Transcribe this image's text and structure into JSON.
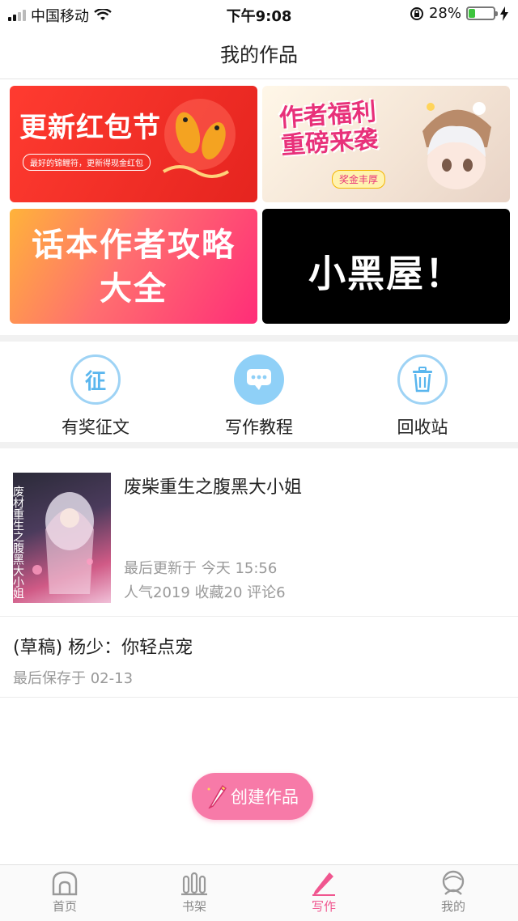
{
  "status_bar": {
    "carrier": "中国移动",
    "time": "下午9:08",
    "battery_percent": "28%",
    "battery_level": 0.28
  },
  "header": {
    "title": "我的作品"
  },
  "banners": {
    "red_envelope": {
      "title": "更新红包节",
      "subtitle": "最好的锦鲤符，更新得现金红包"
    },
    "author_welfare": {
      "title_line1": "作者福利",
      "title_line2": "重磅来袭",
      "tag": "奖金丰厚"
    },
    "guide": {
      "title_line1": "话本作者攻略",
      "title_line2": "大全"
    },
    "blackroom": {
      "title": "小黑屋！"
    }
  },
  "actions": [
    {
      "label": "有奖征文",
      "icon": "zheng-icon",
      "glyph": "征"
    },
    {
      "label": "写作教程",
      "icon": "chat-bubble-icon"
    },
    {
      "label": "回收站",
      "icon": "trash-icon"
    }
  ],
  "works": [
    {
      "title": "废柴重生之腹黑大小姐",
      "updated": "最后更新于 今天 15:56",
      "stats": "人气2019 收藏20 评论6",
      "cover_text": "废材重生之腹黑大小姐"
    },
    {
      "title": "(草稿) 杨少：你轻点宠",
      "saved": "最后保存于 02-13"
    }
  ],
  "create_button": {
    "label": "创建作品"
  },
  "tabbar": [
    {
      "label": "首页",
      "icon": "home-icon"
    },
    {
      "label": "书架",
      "icon": "bookshelf-icon"
    },
    {
      "label": "写作",
      "icon": "pencil-icon",
      "active": true
    },
    {
      "label": "我的",
      "icon": "profile-icon"
    }
  ],
  "colors": {
    "accent_pink": "#f0568f",
    "button_pink": "#f77aa8",
    "icon_blue": "#8fd0f7"
  }
}
